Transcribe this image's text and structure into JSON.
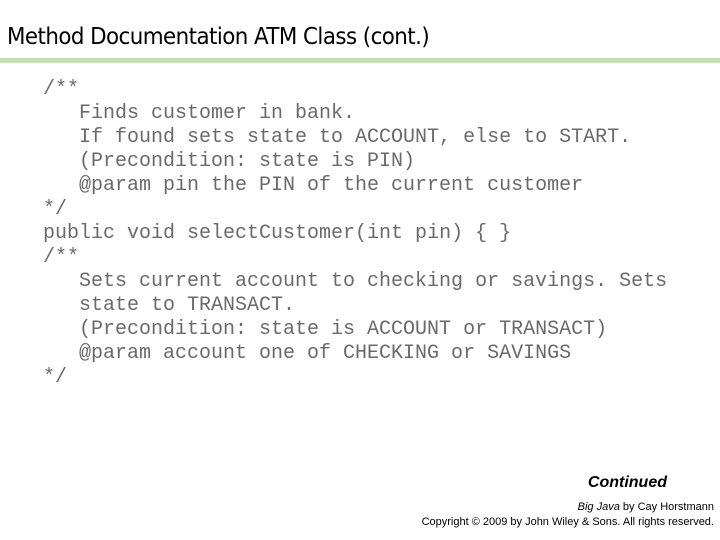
{
  "slide": {
    "title": "Method Documentation ATM Class (cont.)",
    "accent_rule_color": "#c6e0b4"
  },
  "code": {
    "lines": [
      {
        "text": "/**",
        "indent": false
      },
      {
        "text": "Finds customer in bank.",
        "indent": true
      },
      {
        "text": "If found sets state to ACCOUNT, else to START.",
        "indent": true
      },
      {
        "text": "(Precondition: state is PIN)",
        "indent": true
      },
      {
        "text": "@param pin the PIN of the current customer",
        "indent": true
      },
      {
        "text": "*/",
        "indent": false
      },
      {
        "text": "public void selectCustomer(int pin) { }",
        "indent": false
      },
      {
        "text": "/**",
        "indent": false
      },
      {
        "text": "Sets current account to checking or savings. Sets",
        "indent": true
      },
      {
        "text": "state to TRANSACT.",
        "indent": true
      },
      {
        "text": "(Precondition: state is ACCOUNT or TRANSACT)",
        "indent": true
      },
      {
        "text": "@param account one of CHECKING or SAVINGS",
        "indent": true
      },
      {
        "text": "*/",
        "indent": false
      }
    ]
  },
  "footer": {
    "continued_label": "Continued",
    "book_title": "Big Java",
    "book_author_text": " by Cay Horstmann",
    "copyright": "Copyright © 2009 by John Wiley & Sons.  All rights reserved."
  }
}
